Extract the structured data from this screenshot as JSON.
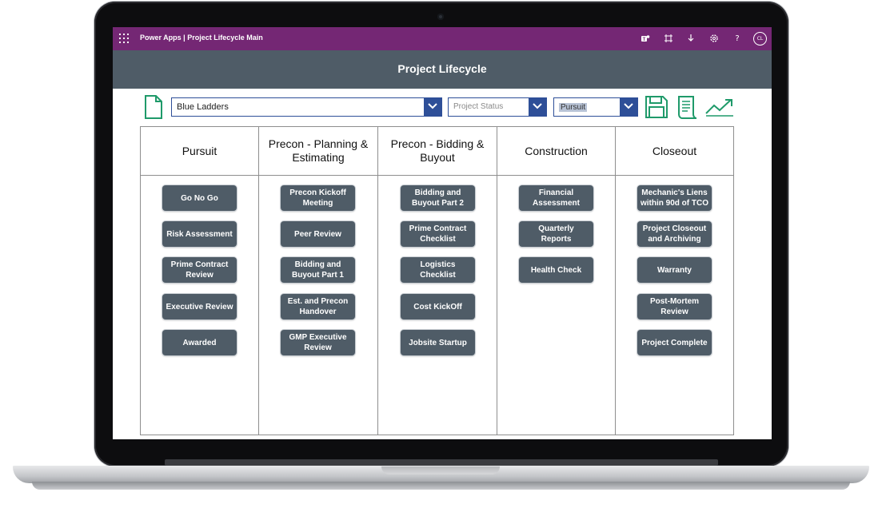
{
  "app": {
    "title": "Power Apps  |  Project Lifecycle Main",
    "user_initials": "CL",
    "accent_color": "#742774",
    "header_color": "#4f5c67",
    "icons": [
      "waffle-icon",
      "teams-icon",
      "fit-screen-icon",
      "download-icon",
      "settings-icon",
      "help-icon"
    ]
  },
  "header": {
    "title": "Project Lifecycle"
  },
  "toolbar": {
    "project_select": {
      "value": "Blue Ladders"
    },
    "status_select": {
      "placeholder": "Project Status"
    },
    "phase_select": {
      "value": "Pursuit"
    },
    "icon_color": "#1f9a6a"
  },
  "columns": [
    {
      "title": "Pursuit",
      "buttons": [
        "Go No Go",
        "Risk Assessment",
        "Prime Contract Review",
        "Executive Review",
        "Awarded"
      ]
    },
    {
      "title": "Precon - Planning & Estimating",
      "buttons": [
        "Precon Kickoff Meeting",
        "Peer Review",
        "Bidding and Buyout Part 1",
        "Est. and Precon Handover",
        "GMP Executive Review"
      ]
    },
    {
      "title": "Precon - Bidding & Buyout",
      "buttons": [
        "Bidding and Buyout Part 2",
        "Prime Contract Checklist",
        "Logistics Checklist",
        "Cost KickOff",
        "Jobsite Startup"
      ]
    },
    {
      "title": "Construction",
      "buttons": [
        "Financial Assessment",
        "Quarterly Reports",
        "Health Check"
      ]
    },
    {
      "title": "Closeout",
      "buttons": [
        "Mechanic's Liens within 90d of TCO",
        "Project Closeout and Archiving",
        "Warranty",
        "Post-Mortem Review",
        "Project Complete"
      ]
    }
  ]
}
